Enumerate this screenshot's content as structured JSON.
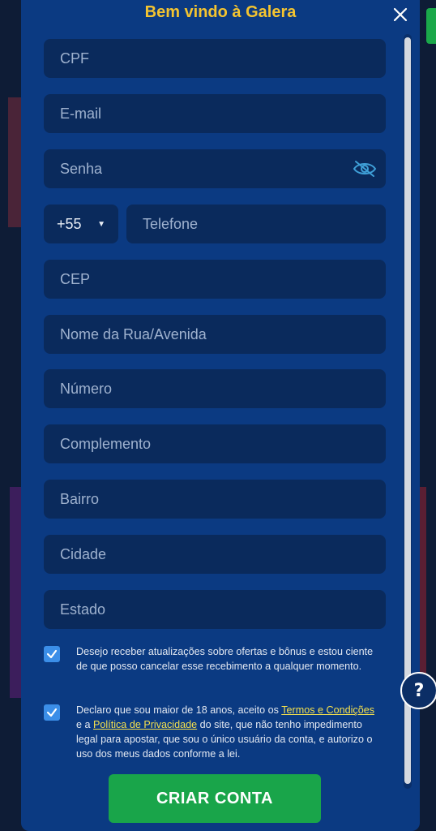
{
  "modal": {
    "title": "Bem vindo à Galera"
  },
  "form": {
    "cpf_placeholder": "CPF",
    "email_placeholder": "E-mail",
    "password_placeholder": "Senha",
    "ddd_value": "+55",
    "phone_placeholder": "Telefone",
    "cep_placeholder": "CEP",
    "street_placeholder": "Nome da Rua/Avenida",
    "number_placeholder": "Número",
    "complement_placeholder": "Complemento",
    "district_placeholder": "Bairro",
    "city_placeholder": "Cidade",
    "state_placeholder": "Estado"
  },
  "consent": {
    "offers_text": "Desejo receber atualizações sobre ofertas e bônus e estou ciente de que posso cancelar esse recebimento a qualquer momento.",
    "age_text_1": "Declaro que sou maior de 18 anos, aceito os ",
    "terms_link": "Termos e Condições",
    "age_text_2": " e a ",
    "privacy_link": "Política de Privacidade",
    "age_text_3": " do site, que não tenho impedimento legal para apostar, que sou o único usuário da conta, e autorizo o uso dos meus dados conforme a lei.",
    "offers_checked": true,
    "age_checked": true
  },
  "actions": {
    "create_account": "CRIAR CONTA",
    "help_label": "?"
  },
  "icons": {
    "close": "close-icon",
    "eye": "eye-off-icon",
    "caret": "chevron-down-icon",
    "check": "check-icon",
    "help": "question-icon"
  },
  "colors": {
    "modal_bg": "#0b3a82",
    "field_bg": "#0a2a5c",
    "title": "#f4c430",
    "cta": "#19a54a",
    "checkbox": "#3b8ee8",
    "link": "#f4e04d"
  }
}
